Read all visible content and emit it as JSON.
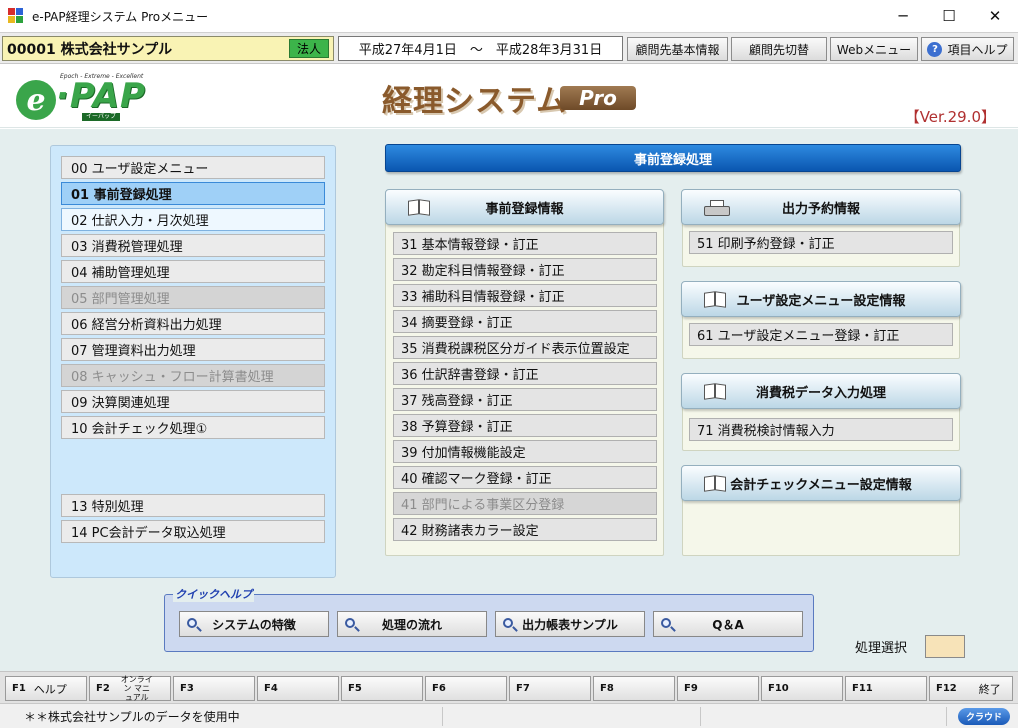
{
  "window": {
    "title": "e-PAP経理システム Proメニュー",
    "controls": {
      "minimize": "─",
      "maximize": "☐",
      "close": "✕"
    }
  },
  "infobar": {
    "company": "00001 株式会社サンプル",
    "corp_type": "法人",
    "period": "平成27年4月1日　～　平成28年3月31日",
    "buttons": [
      "顧問先基本情報",
      "顧問先切替",
      "Webメニュー",
      "項目ヘルプ"
    ]
  },
  "logo": {
    "tagline": "Epoch - Extreme - Excellent",
    "e": "e",
    "pap": "·PAP",
    "sub": "イーパップ",
    "brand": "経理システム",
    "pro": "Pro",
    "version": "【Ver.29.0】"
  },
  "left_menu": [
    {
      "label": "00 ユーザ設定メニュー",
      "state": "normal"
    },
    {
      "label": "01 事前登録処理",
      "state": "selected"
    },
    {
      "label": "02 仕訳入力・月次処理",
      "state": "hover"
    },
    {
      "label": "03 消費税管理処理",
      "state": "normal"
    },
    {
      "label": "04 補助管理処理",
      "state": "normal"
    },
    {
      "label": "05 部門管理処理",
      "state": "disabled"
    },
    {
      "label": "06 経営分析資料出力処理",
      "state": "normal"
    },
    {
      "label": "07 管理資料出力処理",
      "state": "normal"
    },
    {
      "label": "08 キャッシュ・フロー計算書処理",
      "state": "disabled"
    },
    {
      "label": "09 決算関連処理",
      "state": "normal"
    },
    {
      "label": "10 会計チェック処理①",
      "state": "normal"
    },
    {
      "label": "13 特別処理",
      "state": "normal"
    },
    {
      "label": "14 PC会計データ取込処理",
      "state": "normal"
    }
  ],
  "main": {
    "header": "事前登録処理",
    "sections": {
      "advance": {
        "title": "事前登録情報",
        "items": [
          {
            "label": "31 基本情報登録・訂正",
            "disabled": false
          },
          {
            "label": "32 勘定科目情報登録・訂正",
            "disabled": false
          },
          {
            "label": "33 補助科目情報登録・訂正",
            "disabled": false
          },
          {
            "label": "34 摘要登録・訂正",
            "disabled": false
          },
          {
            "label": "35 消費税課税区分ガイド表示位置設定",
            "disabled": false
          },
          {
            "label": "36 仕訳辞書登録・訂正",
            "disabled": false
          },
          {
            "label": "37 残高登録・訂正",
            "disabled": false
          },
          {
            "label": "38 予算登録・訂正",
            "disabled": false
          },
          {
            "label": "39 付加情報機能設定",
            "disabled": false
          },
          {
            "label": "40 確認マーク登録・訂正",
            "disabled": false
          },
          {
            "label": "41 部門による事業区分登録",
            "disabled": true
          },
          {
            "label": "42 財務諸表カラー設定",
            "disabled": false
          }
        ]
      },
      "print": {
        "title": "出力予約情報",
        "items": [
          {
            "label": "51 印刷予約登録・訂正"
          }
        ]
      },
      "user_menu": {
        "title": "ユーザ設定メニュー設定情報",
        "items": [
          {
            "label": "61 ユーザ設定メニュー登録・訂正"
          }
        ]
      },
      "tax_input": {
        "title": "消費税データ入力処理",
        "items": [
          {
            "label": "71 消費税検討情報入力"
          }
        ]
      },
      "check_menu": {
        "title": "会計チェックメニュー設定情報",
        "items": []
      }
    }
  },
  "quick_help": {
    "title": "クイックヘルプ",
    "buttons": [
      "システムの特徴",
      "処理の流れ",
      "出力帳表サンプル",
      "Q＆A"
    ]
  },
  "selection": {
    "label": "処理選択",
    "value": ""
  },
  "function_keys": [
    {
      "key": "F1",
      "label": "ヘルプ"
    },
    {
      "key": "F2",
      "label": "オンライン マニュアル"
    },
    {
      "key": "F3",
      "label": ""
    },
    {
      "key": "F4",
      "label": ""
    },
    {
      "key": "F5",
      "label": ""
    },
    {
      "key": "F6",
      "label": ""
    },
    {
      "key": "F7",
      "label": ""
    },
    {
      "key": "F8",
      "label": ""
    },
    {
      "key": "F9",
      "label": ""
    },
    {
      "key": "F10",
      "label": ""
    },
    {
      "key": "F11",
      "label": ""
    },
    {
      "key": "F12",
      "label": "終了"
    }
  ],
  "status": {
    "text": "＊＊株式会社サンプルのデータを使用中",
    "badge": "クラウド"
  },
  "colors": {
    "accent_blue": "#0a56b0",
    "logo_green": "#3aa54a",
    "brand_brown": "#8a5a2c",
    "version_red": "#b03030"
  }
}
